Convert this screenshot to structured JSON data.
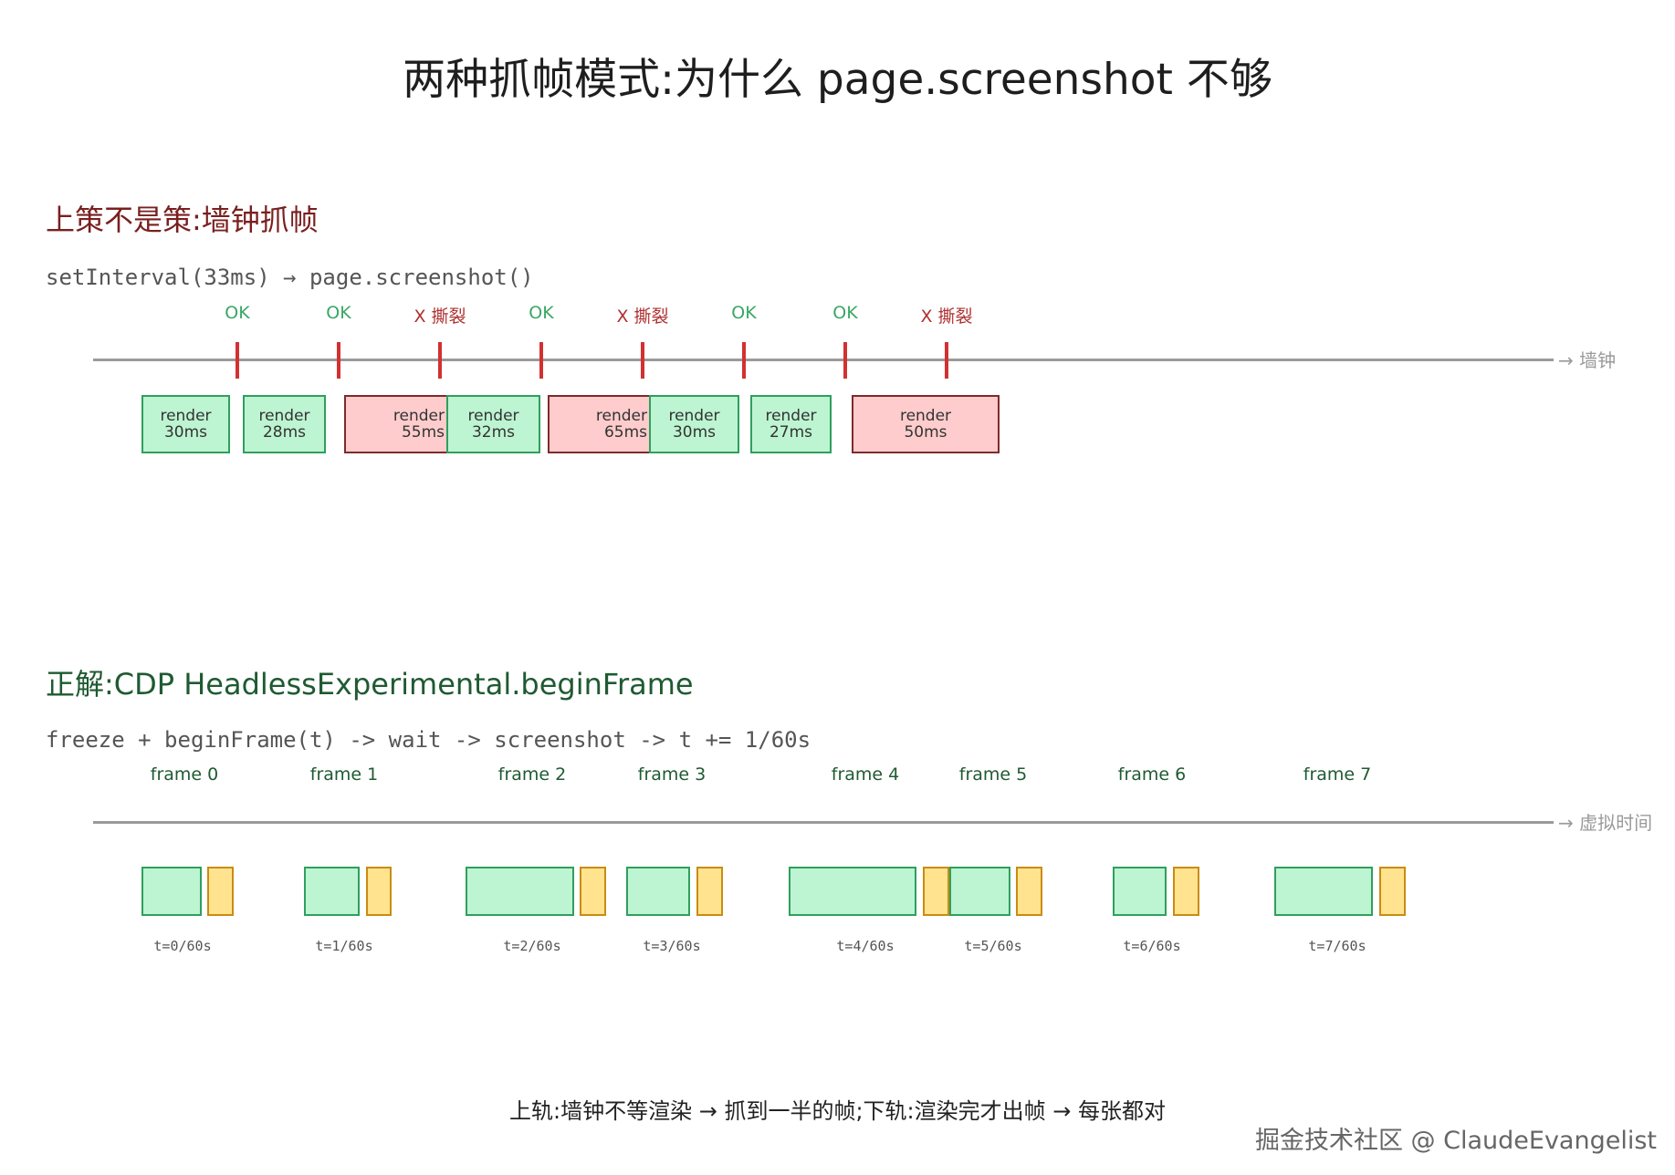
{
  "title": "两种抓帧模式:为什么 page.screenshot 不够",
  "section_top": {
    "heading": "上策不是策:墙钟抓帧",
    "code": "setInterval(33ms) → page.screenshot()",
    "axis_label": "→ 墙钟",
    "tick_labels": [
      "OK",
      "OK",
      "X 撕裂",
      "OK",
      "X 撕裂",
      "OK",
      "OK",
      "X 撕裂"
    ],
    "renders": [
      {
        "label": "render",
        "time": "30ms",
        "status": "green"
      },
      {
        "label": "render",
        "time": "28ms",
        "status": "green"
      },
      {
        "label": "render",
        "time": "55ms",
        "status": "red"
      },
      {
        "label": "render",
        "time": "32ms",
        "status": "green"
      },
      {
        "label": "render",
        "time": "65ms",
        "status": "red"
      },
      {
        "label": "render",
        "time": "30ms",
        "status": "green"
      },
      {
        "label": "render",
        "time": "27ms",
        "status": "green"
      },
      {
        "label": "render",
        "time": "50ms",
        "status": "red"
      }
    ]
  },
  "section_bottom": {
    "heading": "正解:CDP HeadlessExperimental.beginFrame",
    "code": "freeze + beginFrame(t) -> wait -> screenshot -> t += 1/60s",
    "axis_label": "→ 虚拟时间",
    "frames": [
      "frame 0",
      "frame 1",
      "frame 2",
      "frame 3",
      "frame 4",
      "frame 5",
      "frame 6",
      "frame 7"
    ],
    "times": [
      "t=0/60s",
      "t=1/60s",
      "t=2/60s",
      "t=3/60s",
      "t=4/60s",
      "t=5/60s",
      "t=6/60s",
      "t=7/60s"
    ]
  },
  "caption": "上轨:墙钟不等渲染 → 抓到一半的帧;下轨:渲染完才出帧 → 每张都对",
  "watermark": "掘金技术社区 @ ClaudeEvangelist",
  "colors": {
    "ok": "#3aa765",
    "bad": "#b03030",
    "render_green": "#bdf4d2",
    "render_red": "#ffcccd",
    "capture_yellow": "#ffe38e"
  }
}
